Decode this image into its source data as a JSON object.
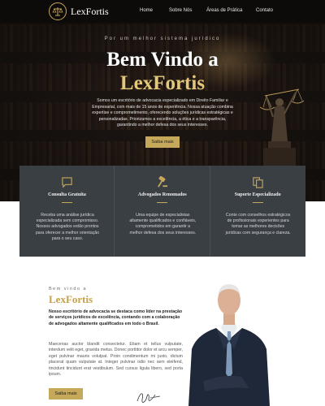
{
  "nav": {
    "brand": "LexFortis",
    "links": [
      "Home",
      "Sobre Nós",
      "Áreas de Prática",
      "Contato"
    ]
  },
  "hero": {
    "tagline": "Por um melhor sistema jurídico",
    "title_line1": "Bem Vindo a",
    "title_line2": "LexFortis",
    "description": "Somos um escritório de advocacia especializado em Direito Familiar e Empresarial, com mais de 15 anos de experiência. Nossa atuação combina expertise e comprometimento, oferecendo soluções jurídicas estratégicas e personalizadas. Priorizamos a excelência, a ética e a transparência, garantindo a melhor defesa dos seus interesses.",
    "button_label": "Saiba mais"
  },
  "features": [
    {
      "icon": "chat-icon",
      "title": "Consulta Gratuita",
      "text": "Receba uma análise jurídica especializada sem compromisso. Nossos advogados estão prontos para oferecer a melhor orientação para o seu caso."
    },
    {
      "icon": "gavel-icon",
      "title": "Advogados Renomados",
      "text": "Uma equipe de especialistas altamente qualificados e confiáveis, comprometidos em garantir a melhor defesa dos seus interesses."
    },
    {
      "icon": "documents-icon",
      "title": "Suporte Especializado",
      "text": "Conte com conselhos estratégicos de profissionais experientes para tomar as melhores decisões jurídicas com segurança e clareza."
    }
  ],
  "about": {
    "tagline": "Bem vindo a",
    "title": "LexFortis",
    "bold_text": "Nosso escritório de advocacia se destaca como líder na prestação de serviços jurídicos de excelência, contando com a colaboração de advogados altamente qualificados em todo o Brasil.",
    "body_text": "Maecenas auctor blandit consectetur. Etiam et tellus vulputate, interdum velit eget, gravida metus. Donec porttitor dolor et arcu semper, eget pulvinar mauris volutpat. Proin condimentum mi justo, dictum placerat quam vulputate at. Integer pulvinar odio nec sem eleifend, tincidunt tincidunt erat vestibulum. Sed cursus ligula libero, sed porta ipsum.",
    "button_label": "Saiba mais"
  },
  "colors": {
    "accent": "#c6a85a",
    "gold_title": "#e2c878",
    "feature_bg": "#3a3f44"
  }
}
